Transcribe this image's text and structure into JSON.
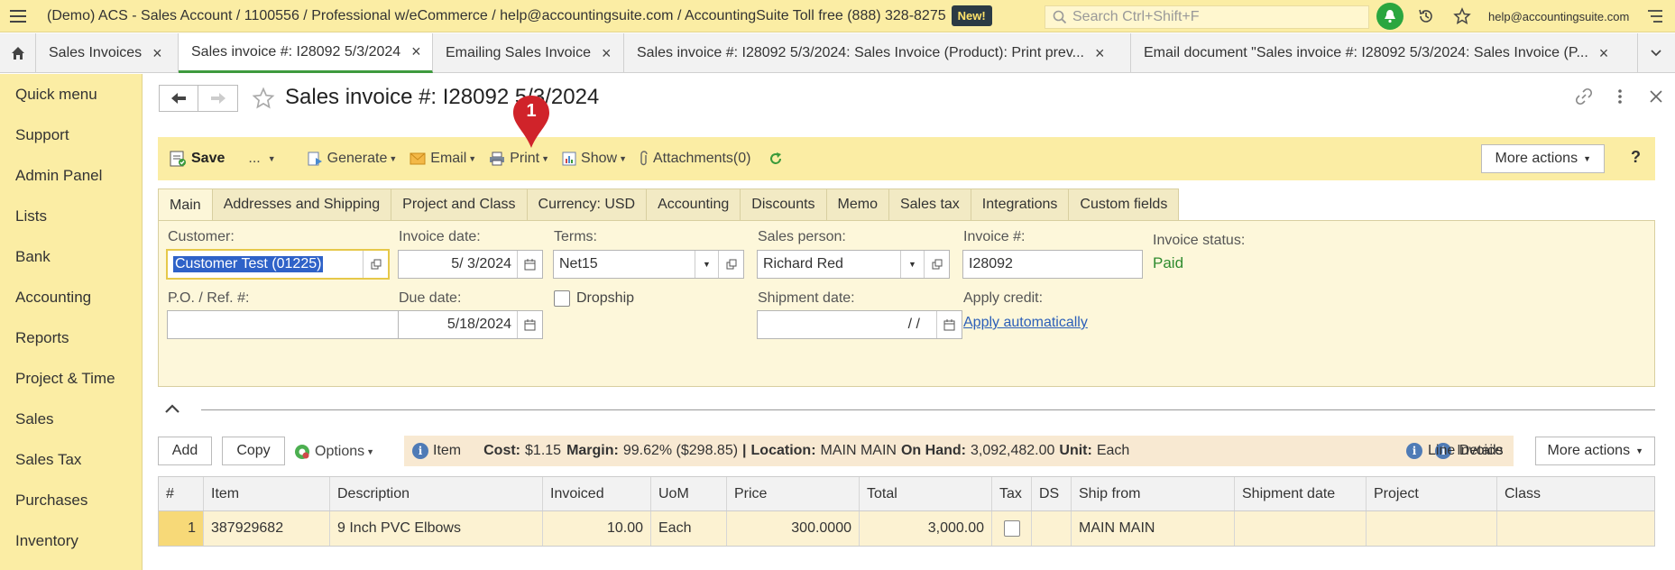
{
  "topbar": {
    "title": "(Demo) ACS - Sales Account / 1100556 / Professional w/eCommerce / help@accountingsuite.com / AccountingSuite Toll free (888) 328-8275",
    "new_badge": "New!",
    "search_placeholder": "Search Ctrl+Shift+F",
    "user_email": "help@accountingsuite.com"
  },
  "tabs": [
    {
      "label": "Sales Invoices"
    },
    {
      "label": "Sales invoice #: I28092 5/3/2024"
    },
    {
      "label": "Emailing Sales Invoice"
    },
    {
      "label": "Sales invoice #: I28092 5/3/2024: Sales Invoice (Product): Print prev..."
    },
    {
      "label": "Email document \"Sales invoice #: I28092 5/3/2024: Sales Invoice (P..."
    }
  ],
  "sidebar": {
    "items": [
      "Quick menu",
      "Support",
      "Admin Panel",
      "Lists",
      "Bank",
      "Accounting",
      "Reports",
      "Project & Time",
      "Sales",
      "Sales Tax",
      "Purchases",
      "Inventory"
    ]
  },
  "doc": {
    "title": "Sales invoice #: I28092 5/3/2024"
  },
  "pin": {
    "number": "1"
  },
  "toolbar": {
    "save": "Save",
    "dots": "...",
    "generate": "Generate",
    "email": "Email",
    "print": "Print",
    "show": "Show",
    "attachments": "Attachments(0)",
    "more_actions": "More actions",
    "help": "?"
  },
  "form_tabs": [
    "Main",
    "Addresses and Shipping",
    "Project and Class",
    "Currency: USD",
    "Accounting",
    "Discounts",
    "Memo",
    "Sales tax",
    "Integrations",
    "Custom fields"
  ],
  "form": {
    "customer_label": "Customer:",
    "customer_value": "Customer Test (01225)",
    "invoice_date_label": "Invoice date:",
    "invoice_date_value": "5/ 3/2024",
    "terms_label": "Terms:",
    "terms_value": "Net15",
    "sales_person_label": "Sales person:",
    "sales_person_value": "Richard Red",
    "invoice_no_label": "Invoice #:",
    "invoice_no_value": "I28092",
    "invoice_status_label": "Invoice status:",
    "invoice_status_value": "Paid",
    "po_label": "P.O. / Ref. #:",
    "po_value": "",
    "due_date_label": "Due date:",
    "due_date_value": "5/18/2024",
    "dropship_label": "Dropship",
    "shipment_date_label": "Shipment date:",
    "shipment_date_value": "/ /",
    "apply_credit_label": "Apply credit:",
    "apply_auto_link": "Apply automatically"
  },
  "lines_toolbar": {
    "add": "Add",
    "copy": "Copy",
    "options": "Options",
    "item_label": "Item",
    "cost_label": "Cost:",
    "cost_value": "$1.15",
    "margin_label": "Margin:",
    "margin_value": "99.62% ($298.85)",
    "sep": "|",
    "location_label": "Location:",
    "location_value": "MAIN MAIN",
    "onhand_label": "On Hand:",
    "onhand_value": "3,092,482.00",
    "unit_label": "Unit:",
    "unit_value": "Each",
    "invoice_label": "Invoice",
    "line_details": "Line Details",
    "more_actions": "More actions"
  },
  "grid": {
    "headers": [
      "#",
      "Item",
      "Description",
      "Invoiced",
      "UoM",
      "Price",
      "Total",
      "Tax",
      "DS",
      "Ship from",
      "Shipment date",
      "Project",
      "Class"
    ],
    "rows": [
      {
        "num": "1",
        "item": "387929682",
        "description": "9 Inch PVC Elbows",
        "invoiced": "10.00",
        "uom": "Each",
        "price": "300.0000",
        "total": "3,000.00",
        "tax": "",
        "ds": "",
        "ship_from": "MAIN MAIN",
        "shipment_date": "",
        "project": "",
        "class": ""
      }
    ]
  },
  "colors": {
    "accent_yellow": "#fbeda4",
    "active_tab_underline": "#3e9a3e",
    "status_paid": "#2e8b2e",
    "pin_red": "#d0232a",
    "link_blue": "#2b5fb8"
  }
}
